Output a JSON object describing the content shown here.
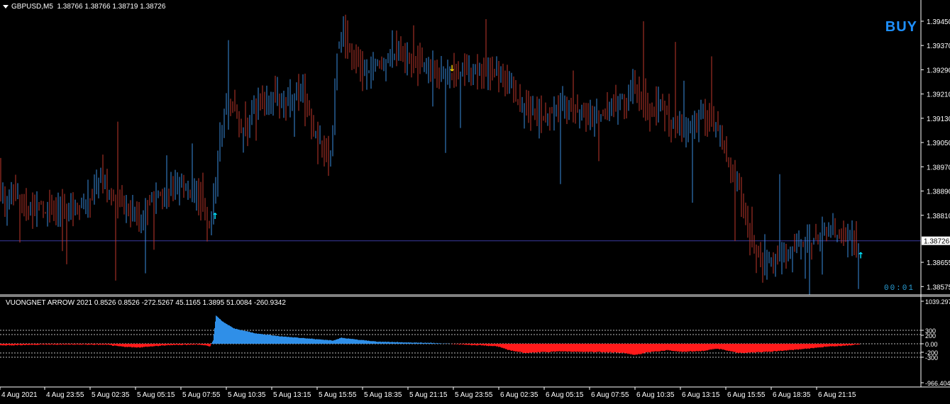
{
  "header": {
    "symbol": "GBPUSD,M5",
    "ohlc": "1.38766 1.38766 1.38719 1.38726"
  },
  "signal_label": "BUY",
  "timer": "00:01",
  "indicator_header": "VUONGNET ARROW 2021  0.8526 0.8526 -272.5267 45.1165 1.3895 51.0084 -260.9342",
  "price_axis": {
    "ticks": [
      "1.39450",
      "1.39370",
      "1.39290",
      "1.39210",
      "1.39130",
      "1.39050",
      "1.38970",
      "1.38890",
      "1.38810",
      "1.38655",
      "1.38575"
    ],
    "current_price": "1.38726"
  },
  "indicator_axis": {
    "ticks": [
      "1039.297",
      "300",
      "200",
      "0.00",
      "-200",
      "-300",
      "-966.404"
    ]
  },
  "time_axis": {
    "labels": [
      "4 Aug 2021",
      "4 Aug 23:55",
      "5 Aug 02:35",
      "5 Aug 05:15",
      "5 Aug 07:55",
      "5 Aug 10:35",
      "5 Aug 13:15",
      "5 Aug 15:55",
      "5 Aug 18:35",
      "5 Aug 21:15",
      "5 Aug 23:55",
      "6 Aug 02:35",
      "6 Aug 05:15",
      "6 Aug 07:55",
      "6 Aug 10:35",
      "6 Aug 13:15",
      "6 Aug 15:55",
      "6 Aug 18:35",
      "6 Aug 21:15"
    ]
  },
  "colors": {
    "background": "#000000",
    "bull": "#3a8ee0",
    "bear": "#c0392b",
    "hist_pos": "#2f8fe8",
    "hist_neg": "#ff1a1a",
    "current_line": "#3a3aa0",
    "arrow_up": "#00e5ff",
    "arrow_down": "#ffd700"
  },
  "chart_data": [
    {
      "type": "candlestick",
      "title": "GBPUSD,M5",
      "ylim": [
        1.3855,
        1.3952
      ],
      "path": [
        [
          0,
          1.3903
        ],
        [
          4,
          1.3888
        ],
        [
          10,
          1.3886
        ],
        [
          25,
          1.3888
        ],
        [
          40,
          1.3882
        ],
        [
          55,
          1.3884
        ],
        [
          70,
          1.3883
        ],
        [
          90,
          1.3883
        ],
        [
          110,
          1.3884
        ],
        [
          130,
          1.3886
        ],
        [
          145,
          1.3894
        ],
        [
          155,
          1.3889
        ],
        [
          170,
          1.3886
        ],
        [
          185,
          1.3884
        ],
        [
          200,
          1.3879
        ],
        [
          215,
          1.3886
        ],
        [
          230,
          1.3888
        ],
        [
          255,
          1.3889
        ],
        [
          265,
          1.3891
        ],
        [
          280,
          1.3888
        ],
        [
          292,
          1.388
        ],
        [
          298,
          1.3877
        ],
        [
          305,
          1.3888
        ],
        [
          310,
          1.3902
        ],
        [
          320,
          1.3915
        ],
        [
          330,
          1.3918
        ],
        [
          345,
          1.3907
        ],
        [
          355,
          1.3913
        ],
        [
          362,
          1.392
        ],
        [
          375,
          1.3917
        ],
        [
          390,
          1.3921
        ],
        [
          405,
          1.3917
        ],
        [
          420,
          1.392
        ],
        [
          430,
          1.3922
        ],
        [
          440,
          1.3912
        ],
        [
          450,
          1.3905
        ],
        [
          460,
          1.3901
        ],
        [
          470,
          1.39
        ],
        [
          478,
          1.3935
        ],
        [
          485,
          1.3943
        ],
        [
          495,
          1.3936
        ],
        [
          505,
          1.3933
        ],
        [
          515,
          1.3927
        ],
        [
          525,
          1.3928
        ],
        [
          540,
          1.3932
        ],
        [
          555,
          1.3935
        ],
        [
          570,
          1.3933
        ],
        [
          590,
          1.3931
        ],
        [
          610,
          1.3929
        ],
        [
          625,
          1.3928
        ],
        [
          640,
          1.3927
        ],
        [
          655,
          1.3929
        ],
        [
          670,
          1.3929
        ],
        [
          690,
          1.3929
        ],
        [
          705,
          1.3928
        ],
        [
          720,
          1.3925
        ],
        [
          735,
          1.3918
        ],
        [
          750,
          1.3914
        ],
        [
          770,
          1.3914
        ],
        [
          790,
          1.3916
        ],
        [
          805,
          1.3917
        ],
        [
          820,
          1.3915
        ],
        [
          840,
          1.3914
        ],
        [
          855,
          1.3914
        ],
        [
          870,
          1.3917
        ],
        [
          885,
          1.3919
        ],
        [
          895,
          1.3925
        ],
        [
          905,
          1.3918
        ],
        [
          920,
          1.3915
        ],
        [
          935,
          1.3918
        ],
        [
          945,
          1.3913
        ],
        [
          960,
          1.3909
        ],
        [
          975,
          1.391
        ],
        [
          990,
          1.3914
        ],
        [
          1000,
          1.3913
        ],
        [
          1015,
          1.391
        ],
        [
          1025,
          1.3902
        ],
        [
          1035,
          1.3895
        ],
        [
          1045,
          1.389
        ],
        [
          1055,
          1.3878
        ],
        [
          1065,
          1.387
        ],
        [
          1075,
          1.3866
        ],
        [
          1085,
          1.3866
        ],
        [
          1100,
          1.3868
        ],
        [
          1115,
          1.3869
        ],
        [
          1130,
          1.3871
        ],
        [
          1145,
          1.3872
        ],
        [
          1160,
          1.3874
        ],
        [
          1175,
          1.3875
        ],
        [
          1190,
          1.3873
        ],
        [
          1200,
          1.3873
        ],
        [
          1212,
          1.3872
        ]
      ],
      "current_price": 1.38726,
      "arrows": [
        {
          "x": 302,
          "dir": "up",
          "price": 1.3881
        },
        {
          "x": 636,
          "dir": "down",
          "price": 1.3929
        },
        {
          "x": 1212,
          "dir": "up",
          "price": 1.3868
        }
      ]
    },
    {
      "type": "area",
      "title": "VUONGNET ARROW 2021",
      "ylim": [
        -966.404,
        1039.297
      ],
      "levels": [
        300,
        200,
        0,
        -200,
        -300
      ],
      "path": [
        [
          0,
          -40
        ],
        [
          60,
          -20
        ],
        [
          120,
          -20
        ],
        [
          150,
          -25
        ],
        [
          165,
          -60
        ],
        [
          180,
          -80
        ],
        [
          195,
          -90
        ],
        [
          210,
          -70
        ],
        [
          240,
          -30
        ],
        [
          280,
          -20
        ],
        [
          296,
          -60
        ],
        [
          300,
          120
        ],
        [
          304,
          1039
        ],
        [
          315,
          780
        ],
        [
          330,
          560
        ],
        [
          360,
          380
        ],
        [
          400,
          260
        ],
        [
          440,
          180
        ],
        [
          470,
          120
        ],
        [
          480,
          220
        ],
        [
          500,
          160
        ],
        [
          530,
          80
        ],
        [
          570,
          50
        ],
        [
          610,
          30
        ],
        [
          640,
          -10
        ],
        [
          700,
          -60
        ],
        [
          715,
          -150
        ],
        [
          740,
          -230
        ],
        [
          760,
          -210
        ],
        [
          790,
          -190
        ],
        [
          820,
          -200
        ],
        [
          860,
          -210
        ],
        [
          880,
          -230
        ],
        [
          895,
          -280
        ],
        [
          910,
          -220
        ],
        [
          940,
          -160
        ],
        [
          960,
          -200
        ],
        [
          990,
          -180
        ],
        [
          1010,
          -120
        ],
        [
          1020,
          -150
        ],
        [
          1040,
          -230
        ],
        [
          1080,
          -200
        ],
        [
          1120,
          -150
        ],
        [
          1160,
          -80
        ],
        [
          1200,
          -30
        ],
        [
          1212,
          -10
        ]
      ]
    }
  ]
}
